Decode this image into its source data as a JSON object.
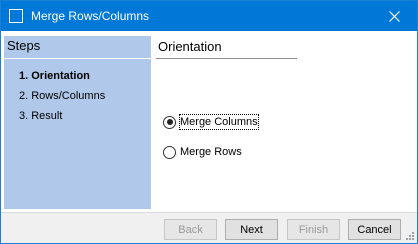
{
  "window": {
    "title": "Merge Rows/Columns"
  },
  "steps": {
    "header": "Steps",
    "items": [
      {
        "label": "1. Orientation"
      },
      {
        "label": "2. Rows/Columns"
      },
      {
        "label": "3. Result"
      }
    ]
  },
  "page": {
    "title": "Orientation",
    "options": [
      {
        "label": "Merge Columns",
        "checked": true
      },
      {
        "label": "Merge Rows",
        "checked": false
      }
    ]
  },
  "footer": {
    "back": "Back",
    "next": "Next",
    "finish": "Finish",
    "cancel": "Cancel"
  },
  "colors": {
    "titlebar": "#0078d7",
    "steps_panel": "#b0c8ea"
  }
}
